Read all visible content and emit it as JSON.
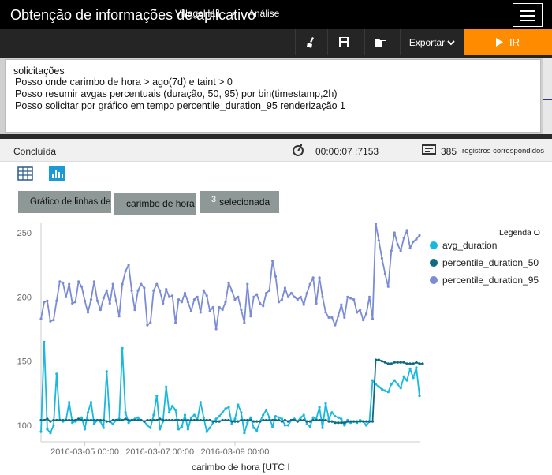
{
  "header": {
    "app_title": "Obtenção de informações de aplicativo",
    "breadcrumb_resource": "VillageHall",
    "breadcrumb_separator": "›",
    "breadcrumb_section": "Análise"
  },
  "toolbar": {
    "export_label": "Exportar",
    "run_label": "IR",
    "icons": [
      "broom-icon",
      "save-icon",
      "open-folder-icon",
      "chevron-down-icon",
      "play-icon"
    ]
  },
  "query": {
    "lines": [
      "solicitações",
      "Posso onde carimbo de hora > ago(7d) e taint > 0",
      "Posso resumir avgas percentuais (duração, 50, 95) por bin(timestamp,2h)",
      "Posso solicitar por gráfico em tempo percentile_duration_95 renderização 1"
    ]
  },
  "status": {
    "state": "Concluída",
    "elapsed": "00:00:07 :7153",
    "record_count": "385",
    "records_label": "registros correspondidos"
  },
  "view_icons": [
    "table-view-icon",
    "chart-view-icon"
  ],
  "chips": {
    "chart_type": "Gráfico de linhas de IZ",
    "x_axis": "carimbo de hora",
    "count": "3",
    "selected_label": "selecionada"
  },
  "legend_title": "Legenda O",
  "colors": {
    "avg_duration": "#1ab8e0",
    "percentile_duration_50": "#0e6b80",
    "percentile_duration_95": "#7b8cd6",
    "run_button": "#ff8c00"
  },
  "chart_data": {
    "type": "line",
    "xlabel": "carimbo de hora [UTC I",
    "ylabel": "",
    "x_tick_labels": [
      "2016-03-05 00:00",
      "2016-03-07 00:00",
      "2016-03-09 00:00"
    ],
    "y_tick_labels": [
      "100",
      "150",
      "200",
      "250"
    ],
    "ylim": [
      92,
      258
    ],
    "legend_position": "right",
    "grid": false,
    "x_start": "2016-03-03 20:00",
    "x_interval_hours": 2,
    "series": [
      {
        "name": "avg_duration",
        "values": [
          95,
          165,
          97,
          94,
          100,
          140,
          104,
          103,
          104,
          118,
          102,
          103,
          104,
          106,
          97,
          110,
          118,
          101,
          104,
          103,
          98,
          142,
          103,
          101,
          104,
          105,
          160,
          110,
          102,
          104,
          105,
          106,
          104,
          103,
          100,
          98,
          108,
          123,
          97,
          103,
          130,
          110,
          115,
          112,
          97,
          99,
          108,
          97,
          106,
          108,
          104,
          118,
          106,
          95,
          98,
          102,
          105,
          107,
          110,
          113,
          114,
          101,
          105,
          116,
          110,
          94,
          102,
          106,
          98,
          96,
          103,
          108,
          112,
          106,
          99,
          107,
          106,
          105,
          100,
          100,
          104,
          105,
          103,
          106,
          108,
          101,
          99,
          106,
          105,
          114,
          98,
          117,
          105,
          110,
          107,
          106,
          105,
          100,
          104,
          102,
          103,
          102,
          104,
          103,
          100,
          103,
          135,
          132,
          130,
          128,
          127,
          126,
          132,
          135,
          132,
          129,
          138,
          135,
          144,
          137,
          145,
          123
        ]
      },
      {
        "name": "percentile_duration_50",
        "values": [
          104,
          104,
          105,
          103,
          104,
          104,
          104,
          104,
          104,
          104,
          104,
          104,
          105,
          104,
          104,
          104,
          104,
          104,
          104,
          104,
          104,
          103,
          103,
          104,
          104,
          104,
          104,
          105,
          104,
          104,
          104,
          104,
          104,
          103,
          104,
          104,
          104,
          104,
          105,
          104,
          104,
          104,
          104,
          104,
          104,
          104,
          104,
          104,
          104,
          104,
          104,
          104,
          104,
          104,
          104,
          103,
          103,
          103,
          104,
          104,
          104,
          103,
          103,
          103,
          104,
          104,
          104,
          104,
          103,
          103,
          103,
          104,
          104,
          104,
          104,
          104,
          104,
          103,
          104,
          103,
          104,
          104,
          103,
          104,
          104,
          103,
          103,
          104,
          104,
          104,
          104,
          104,
          103,
          103,
          102,
          102,
          102,
          102,
          103,
          103,
          103,
          103,
          103,
          103,
          103,
          103,
          103,
          151,
          151,
          150,
          149,
          148,
          148,
          149,
          149,
          149,
          149,
          148,
          148,
          148,
          149,
          148,
          148
        ]
      },
      {
        "name": "percentile_duration_95",
        "values": [
          183,
          196,
          197,
          181,
          182,
          197,
          212,
          211,
          200,
          210,
          195,
          196,
          212,
          208,
          197,
          188,
          198,
          212,
          197,
          190,
          199,
          205,
          195,
          210,
          197,
          185,
          210,
          220,
          225,
          205,
          190,
          205,
          210,
          207,
          178,
          180,
          205,
          210,
          205,
          195,
          206,
          200,
          201,
          180,
          198,
          196,
          203,
          196,
          189,
          198,
          200,
          188,
          205,
          201,
          189,
          192,
          175,
          192,
          190,
          196,
          211,
          205,
          198,
          200,
          190,
          180,
          210,
          185,
          200,
          202,
          195,
          193,
          203,
          205,
          228,
          216,
          196,
          198,
          207,
          200,
          203,
          200,
          198,
          200,
          194,
          203,
          210,
          215,
          195,
          215,
          200,
          188,
          184,
          184,
          178,
          185,
          194,
          184,
          200,
          199,
          198,
          188,
          190,
          182,
          187,
          200,
          183,
          257,
          244,
          230,
          218,
          208,
          236,
          250,
          241,
          236,
          246,
          252,
          238,
          243,
          245,
          248
        ]
      }
    ]
  }
}
